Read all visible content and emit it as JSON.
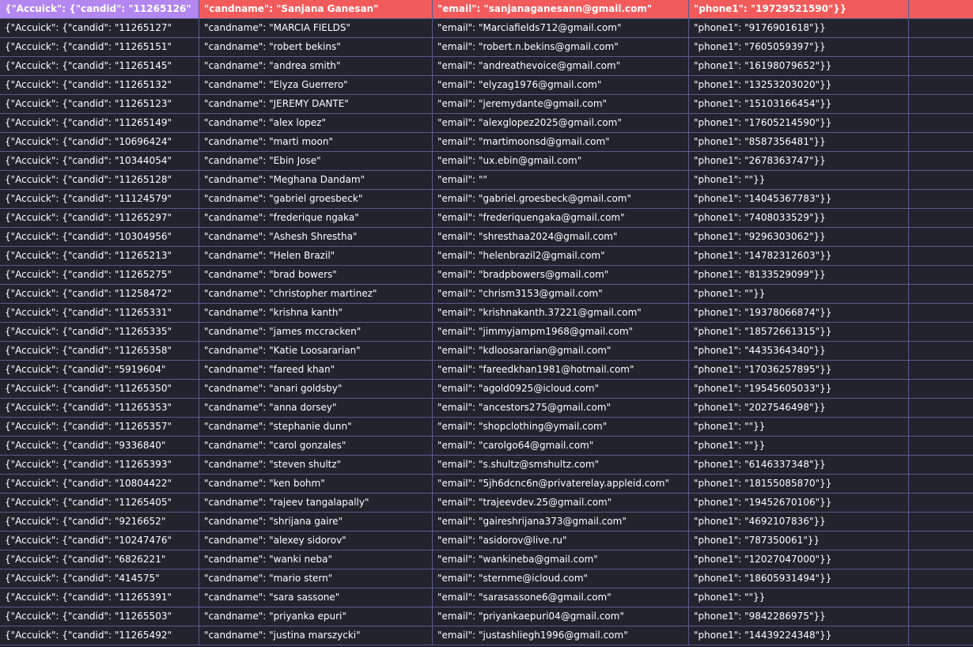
{
  "header": {
    "c0": "{\"Accuick\": {\"candid\": \"11265126\"",
    "c1": "\"candname\": \"Sanjana Ganesan\"",
    "c2": "\"email\": \"sanjanaganesann@gmail.com\"",
    "c3": "\"phone1\": \"19729521590\"}}",
    "c4": ""
  },
  "rows": [
    [
      "{\"Accuick\": {\"candid\": \"11265127\"",
      "\"candname\": \"MARCIA FIELDS\"",
      "\"email\": \"Marciafields712@gmail.com\"",
      "\"phone1\": \"9176901618\"}}"
    ],
    [
      "{\"Accuick\": {\"candid\": \"11265151\"",
      "\"candname\": \"robert bekins\"",
      "\"email\": \"robert.n.bekins@gmail.com\"",
      "\"phone1\": \"7605059397\"}}"
    ],
    [
      "{\"Accuick\": {\"candid\": \"11265145\"",
      "\"candname\": \"andrea smith\"",
      "\"email\": \"andreathevoice@gmail.com\"",
      "\"phone1\": \"16198079652\"}}"
    ],
    [
      "{\"Accuick\": {\"candid\": \"11265132\"",
      "\"candname\": \"Elyza Guerrero\"",
      "\"email\": \"elyzag1976@gmail.com\"",
      "\"phone1\": \"13253203020\"}}"
    ],
    [
      "{\"Accuick\": {\"candid\": \"11265123\"",
      "\"candname\": \"JEREMY DANTE\"",
      "\"email\": \"jeremydante@gmail.com\"",
      "\"phone1\": \"15103166454\"}}"
    ],
    [
      "{\"Accuick\": {\"candid\": \"11265149\"",
      "\"candname\": \"alex lopez\"",
      "\"email\": \"alexglopez2025@gmail.com\"",
      "\"phone1\": \"17605214590\"}}"
    ],
    [
      "{\"Accuick\": {\"candid\": \"10696424\"",
      "\"candname\": \"marti moon\"",
      "\"email\": \"martimoonsd@gmail.com\"",
      "\"phone1\": \"8587356481\"}}"
    ],
    [
      "{\"Accuick\": {\"candid\": \"10344054\"",
      "\"candname\": \"Ebin Jose\"",
      "\"email\": \"ux.ebin@gmail.com\"",
      "\"phone1\": \"2678363747\"}}"
    ],
    [
      "{\"Accuick\": {\"candid\": \"11265128\"",
      "\"candname\": \"Meghana Dandam\"",
      "\"email\": \"\"",
      "\"phone1\": \"\"}}"
    ],
    [
      "{\"Accuick\": {\"candid\": \"11124579\"",
      "\"candname\": \"gabriel groesbeck\"",
      "\"email\": \"gabriel.groesbeck@gmail.com\"",
      "\"phone1\": \"14045367783\"}}"
    ],
    [
      "{\"Accuick\": {\"candid\": \"11265297\"",
      "\"candname\": \"frederique ngaka\"",
      "\"email\": \"frederiquengaka@gmail.com\"",
      "\"phone1\": \"7408033529\"}}"
    ],
    [
      "{\"Accuick\": {\"candid\": \"10304956\"",
      "\"candname\": \"Ashesh Shrestha\"",
      "\"email\": \"shresthaa2024@gmail.com\"",
      "\"phone1\": \"9296303062\"}}"
    ],
    [
      "{\"Accuick\": {\"candid\": \"11265213\"",
      "\"candname\": \"Helen Brazil\"",
      "\"email\": \"helenbrazil2@gmail.com\"",
      "\"phone1\": \"14782312603\"}}"
    ],
    [
      "{\"Accuick\": {\"candid\": \"11265275\"",
      "\"candname\": \"brad bowers\"",
      "\"email\": \"bradpbowers@gmail.com\"",
      "\"phone1\": \"8133529099\"}}"
    ],
    [
      "{\"Accuick\": {\"candid\": \"11258472\"",
      "\"candname\": \"christopher martinez\"",
      "\"email\": \"chrism3153@gmail.com\"",
      "\"phone1\": \"\"}}"
    ],
    [
      "{\"Accuick\": {\"candid\": \"11265331\"",
      "\"candname\": \"krishna kanth\"",
      "\"email\": \"krishnakanth.37221@gmail.com\"",
      "\"phone1\": \"19378066874\"}}"
    ],
    [
      "{\"Accuick\": {\"candid\": \"11265335\"",
      "\"candname\": \"james mccracken\"",
      "\"email\": \"jimmyjampm1968@gmail.com\"",
      "\"phone1\": \"18572661315\"}}"
    ],
    [
      "{\"Accuick\": {\"candid\": \"11265358\"",
      "\"candname\": \"Katie Loosararian\"",
      "\"email\": \"kdloosararian@gmail.com\"",
      "\"phone1\": \"4435364340\"}}"
    ],
    [
      "{\"Accuick\": {\"candid\": \"5919604\"",
      "\"candname\": \"fareed khan\"",
      "\"email\": \"fareedkhan1981@hotmail.com\"",
      "\"phone1\": \"17036257895\"}}"
    ],
    [
      "{\"Accuick\": {\"candid\": \"11265350\"",
      "\"candname\": \"anari goldsby\"",
      "\"email\": \"agold0925@icloud.com\"",
      "\"phone1\": \"19545605033\"}}"
    ],
    [
      "{\"Accuick\": {\"candid\": \"11265353\"",
      "\"candname\": \"anna dorsey\"",
      "\"email\": \"ancestors275@gmail.com\"",
      "\"phone1\": \"2027546498\"}}"
    ],
    [
      "{\"Accuick\": {\"candid\": \"11265357\"",
      "\"candname\": \"stephanie dunn\"",
      "\"email\": \"shopclothing@ymail.com\"",
      "\"phone1\": \"\"}}"
    ],
    [
      "{\"Accuick\": {\"candid\": \"9336840\"",
      "\"candname\": \"carol gonzales\"",
      "\"email\": \"carolgo64@gmail.com\"",
      "\"phone1\": \"\"}}"
    ],
    [
      "{\"Accuick\": {\"candid\": \"11265393\"",
      "\"candname\": \"steven shultz\"",
      "\"email\": \"s.shultz@smshultz.com\"",
      "\"phone1\": \"6146337348\"}}"
    ],
    [
      "{\"Accuick\": {\"candid\": \"10804422\"",
      "\"candname\": \"ken bohm\"",
      "\"email\": \"5jh6dcnc6n@privaterelay.appleid.com\"",
      "\"phone1\": \"18155085870\"}}"
    ],
    [
      "{\"Accuick\": {\"candid\": \"11265405\"",
      "\"candname\": \"rajeev tangalapally\"",
      "\"email\": \"trajeevdev.25@gmail.com\"",
      "\"phone1\": \"19452670106\"}}"
    ],
    [
      "{\"Accuick\": {\"candid\": \"9216652\"",
      "\"candname\": \"shrijana gaire\"",
      "\"email\": \"gaireshrijana373@gmail.com\"",
      "\"phone1\": \"4692107836\"}}"
    ],
    [
      "{\"Accuick\": {\"candid\": \"10247476\"",
      "\"candname\": \"alexey sidorov\"",
      "\"email\": \"asidorov@live.ru\"",
      "\"phone1\": \"787350061\"}}"
    ],
    [
      "{\"Accuick\": {\"candid\": \"6826221\"",
      "\"candname\": \"wanki neba\"",
      "\"email\": \"wankineba@gmail.com\"",
      "\"phone1\": \"12027047000\"}}"
    ],
    [
      "{\"Accuick\": {\"candid\": \"414575\"",
      "\"candname\": \"mario stern\"",
      "\"email\": \"sternme@icloud.com\"",
      "\"phone1\": \"18605931494\"}}"
    ],
    [
      "{\"Accuick\": {\"candid\": \"11265391\"",
      "\"candname\": \"sara sassone\"",
      "\"email\": \"sarasassone6@gmail.com\"",
      "\"phone1\": \"\"}}"
    ],
    [
      "{\"Accuick\": {\"candid\": \"11265503\"",
      "\"candname\": \"priyanka epuri\"",
      "\"email\": \"priyankaepuri04@gmail.com\"",
      "\"phone1\": \"9842286975\"}}"
    ],
    [
      "{\"Accuick\": {\"candid\": \"11265492\"",
      "\"candname\": \"justina marszycki\"",
      "\"email\": \"justashliegh1996@gmail.com\"",
      "\"phone1\": \"14439224348\"}}"
    ]
  ]
}
